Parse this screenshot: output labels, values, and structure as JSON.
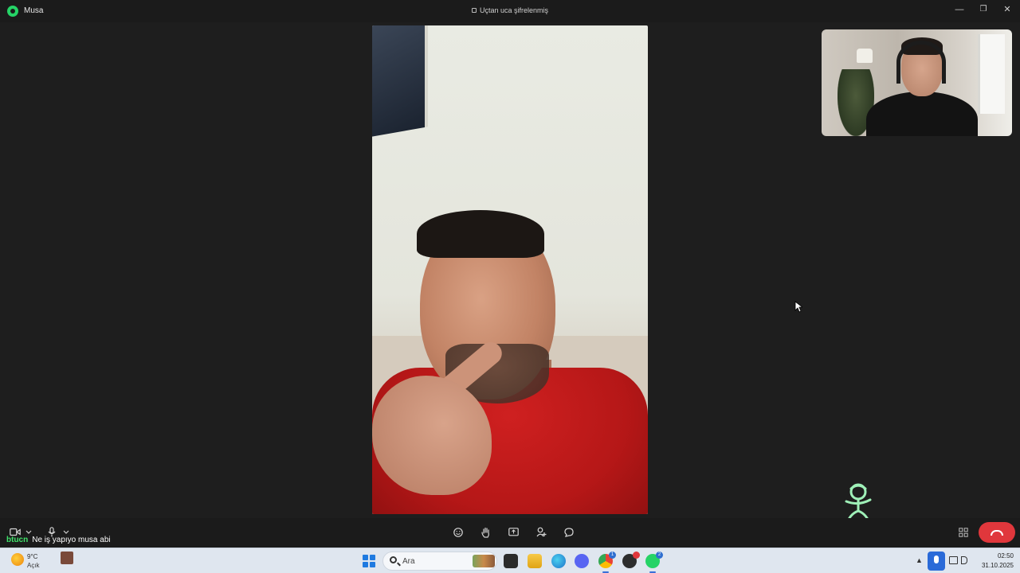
{
  "titlebar": {
    "contact_name": "Musa",
    "encryption_text": "Uçtan uca şifrelenmiş",
    "minimize": "—",
    "restore": "❐",
    "close": "✕"
  },
  "toolbar": {
    "camera_icon": "video-camera-icon",
    "mic_icon": "microphone-icon",
    "emoji_icon": "emoji-icon",
    "raise_hand_icon": "raise-hand-icon",
    "share_screen_icon": "share-screen-icon",
    "add_participant_icon": "add-participant-icon",
    "chat_icon": "chat-icon",
    "layout_icon": "grid-layout-icon",
    "end_call_icon": "end-call-icon",
    "end_call_color": "#e0373c"
  },
  "chat": {
    "username": "btucn",
    "message": "Ne iş yapıyo musa abi",
    "username_color": "#40e36b"
  },
  "taskbar": {
    "weather_temp": "9°C",
    "weather_condition": "Açık",
    "search_placeholder": "Ara",
    "chrome_badge": "1",
    "whatsapp_badge": "2",
    "time": "02:50",
    "date": "31.10.2025",
    "accent_color": "#2a6ad8"
  }
}
